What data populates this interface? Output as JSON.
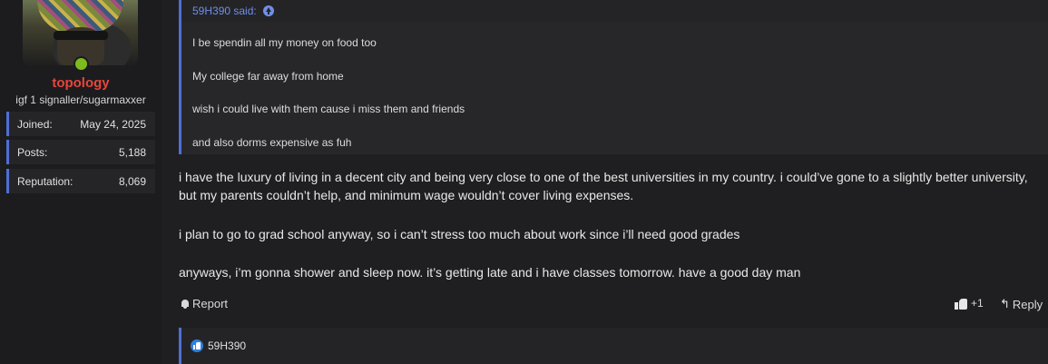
{
  "user": {
    "name": "topology",
    "title": "igf 1 signaller/sugarmaxxer",
    "status_color": "#7fba1e",
    "stats": [
      {
        "label": "Joined:",
        "value": "May 24, 2025"
      },
      {
        "label": "Posts:",
        "value": "5,188"
      },
      {
        "label": "Reputation:",
        "value": "8,069"
      }
    ]
  },
  "quote": {
    "author_line": "59H390 said:",
    "lines": [
      "I be spendin all my money on food too",
      "My college far away from home",
      "wish i could live with them cause i miss them and friends",
      "and also dorms expensive as fuh"
    ]
  },
  "post": {
    "paragraphs": [
      "i have the luxury of living in a decent city and being very close to one of the best universities in my country. i could’ve gone to a slightly better university, but my parents couldn’t help, and minimum wage wouldn’t cover living expenses.",
      "i plan to go to grad school anyway, so i can’t stress too much about work since i’ll need good grades",
      "anyways, i’m gonna shower and sleep now. it’s getting late and i have classes tomorrow. have a good day man"
    ]
  },
  "actions": {
    "report_label": "Report",
    "like_count": "+1",
    "reply_label": "Reply"
  },
  "reactions": {
    "users": "59H390"
  },
  "colors": {
    "accent": "#4f6fd6",
    "username": "#e8453c",
    "link": "#6f8fe8",
    "like_badge": "#2e7fe0"
  }
}
